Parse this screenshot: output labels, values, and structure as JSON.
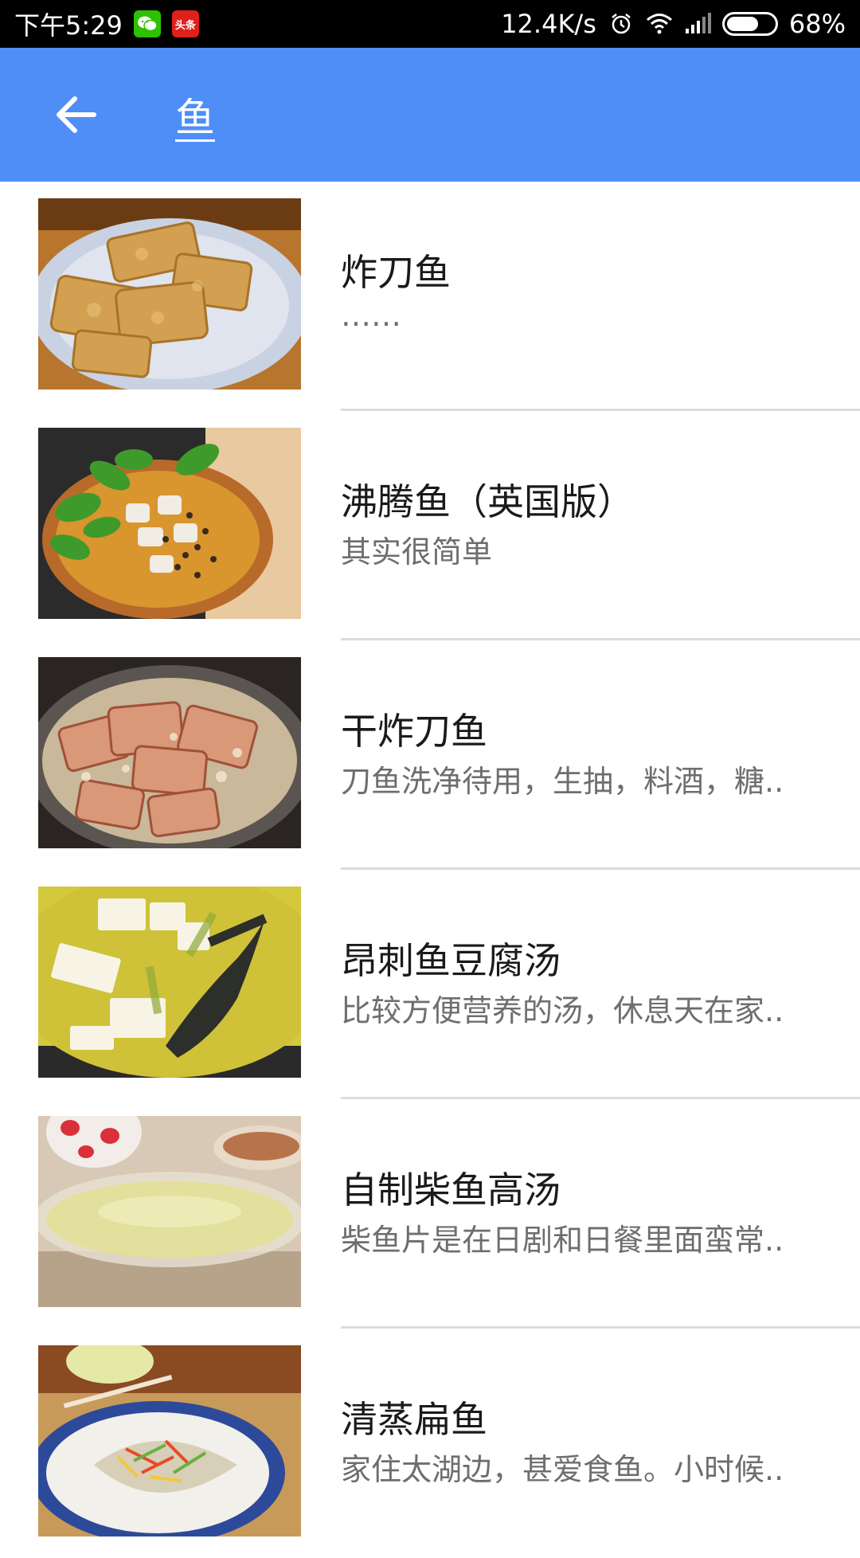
{
  "status_bar": {
    "time": "下午5:29",
    "toutiao_label": "头条",
    "network_speed": "12.4K/s",
    "battery_percent": "68%",
    "battery_level": 0.68
  },
  "app_bar": {
    "title": "鱼"
  },
  "items": [
    {
      "title": "炸刀鱼",
      "desc": "……"
    },
    {
      "title": "沸腾鱼（英国版）",
      "desc": "其实很简单"
    },
    {
      "title": "干炸刀鱼",
      "desc": "刀鱼洗净待用，生抽，料酒，糖.."
    },
    {
      "title": "昂刺鱼豆腐汤",
      "desc": "比较方便营养的汤，休息天在家.."
    },
    {
      "title": "自制柴鱼高汤",
      "desc": "柴鱼片是在日剧和日餐里面蛮常.."
    },
    {
      "title": "清蒸扁鱼",
      "desc": "家住太湖边，甚爱食鱼。小时候.."
    }
  ]
}
